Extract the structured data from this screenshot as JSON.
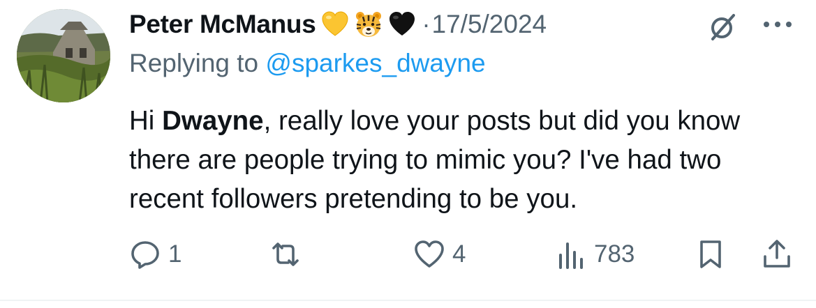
{
  "author": {
    "name": "Peter McManus",
    "emojis": [
      "yellow-heart",
      "tiger-face",
      "black-heart"
    ],
    "separator": "·",
    "date": "17/5/2024"
  },
  "reply": {
    "prefix": "Replying to ",
    "handle": "@sparkes_dwayne"
  },
  "post": {
    "greeting": "Hi ",
    "mention_name": "Dwayne",
    "text_rest": ", really love your posts but did you know there are people trying to mimic you? I've had two recent followers pretending to be you."
  },
  "actions": {
    "replies": "1",
    "likes": "4",
    "views": "783"
  },
  "colors": {
    "text_primary": "#0f1419",
    "text_secondary": "#536471",
    "link": "#1d9bf0"
  }
}
